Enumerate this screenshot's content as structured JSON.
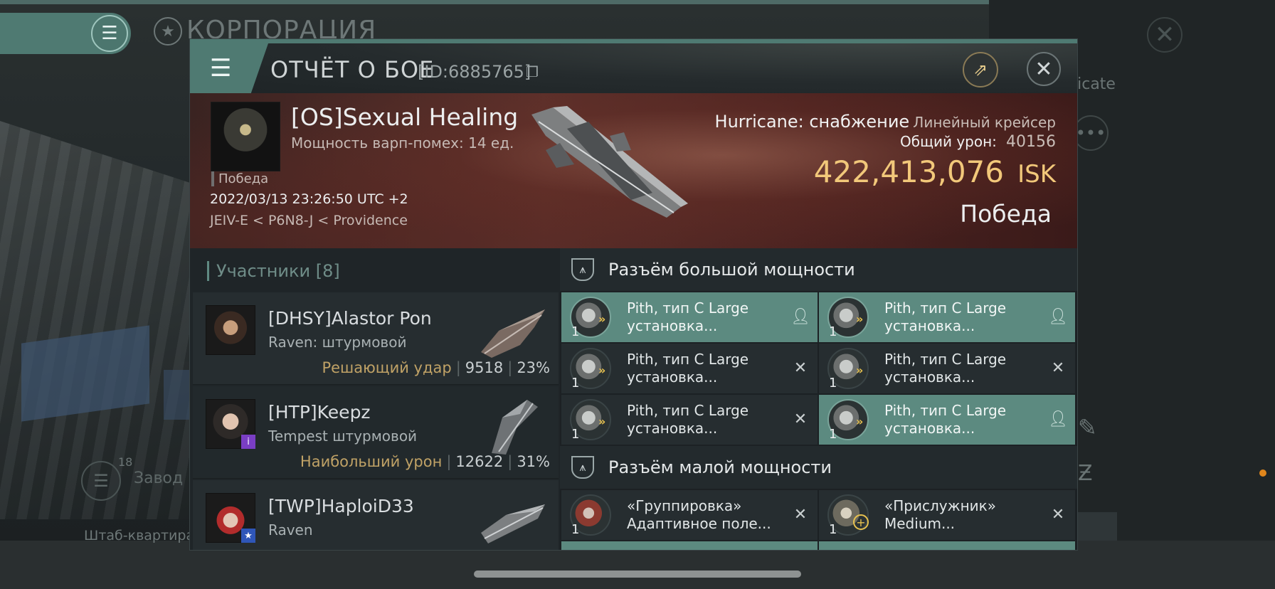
{
  "background": {
    "corp_title": "КОРПОРАЦИЯ",
    "right_partial_text": "licate",
    "factory_count": "18",
    "factory_label": "Завод",
    "hq_label": "Штаб-квартира"
  },
  "header": {
    "title": "ОТЧЁТ О БОЕ",
    "id": "[ID:6885765]"
  },
  "victim": {
    "name": "[OS]Sexual Healing",
    "warp": "Мощность варп-помех: 14 ед.",
    "status": "Победа",
    "datetime": "2022/03/13 23:26:50 UTC +2",
    "location": "JEIV-E < P6N8-J < Providence",
    "ship_name": "Hurricane: снабжение",
    "ship_class": "Линейный крейсер",
    "damage_label": "Общий урон:",
    "damage_value": "40156",
    "isk_value": "422,413,076",
    "isk_unit": "ISK",
    "result": "Победа"
  },
  "participants": {
    "header": "Участники [8]",
    "rows": [
      {
        "name": "[DHSY]Alastor Pon",
        "ship": "Raven: штурмовой",
        "label": "Решающий удар",
        "damage": "9518",
        "percent": "23%"
      },
      {
        "name": "[HTP]Keepz",
        "ship": "Tempest штурмовой",
        "label": "Наибольший урон",
        "damage": "12622",
        "percent": "31%"
      },
      {
        "name": "[TWP]HaploiD33",
        "ship": "Raven"
      }
    ]
  },
  "modules": {
    "high_slot_title": "Разъём большой мощности",
    "low_slot_title": "Разъём малой мощности",
    "high": [
      {
        "qty": "1",
        "name": "Pith, тип C Large установка..."
      },
      {
        "qty": "1",
        "name": "Pith, тип C Large установка..."
      },
      {
        "qty": "1",
        "name": "Pith, тип C Large установка..."
      },
      {
        "qty": "1",
        "name": "Pith, тип C Large установка..."
      },
      {
        "qty": "1",
        "name": "Pith, тип C Large установка..."
      },
      {
        "qty": "1",
        "name": "Pith, тип C Large установка..."
      }
    ],
    "low": [
      {
        "qty": "1",
        "name": "«Группировка» Адаптивное поле..."
      },
      {
        "qty": "1",
        "name": "«Прислужник» Medium..."
      }
    ]
  }
}
